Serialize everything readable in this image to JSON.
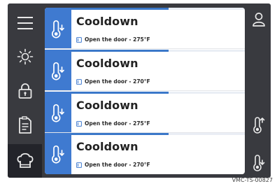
{
  "sidebar": {
    "items": [
      {
        "icon": "menu-icon"
      },
      {
        "icon": "sun-icon"
      },
      {
        "icon": "lock-icon"
      },
      {
        "icon": "document-icon"
      },
      {
        "icon": "chef-hat-icon",
        "active": true
      }
    ]
  },
  "right_bar": {
    "items": [
      {
        "icon": "user-icon"
      },
      {
        "icon": "thermometer-up-icon"
      },
      {
        "icon": "thermometer-down-icon"
      }
    ]
  },
  "cards": [
    {
      "title": "Cooldown",
      "subtitle": "Open the door - 275°F",
      "progress": 0.62
    },
    {
      "title": "Cooldown",
      "subtitle": "Open the door - 270°F",
      "progress": 0.62
    },
    {
      "title": "Cooldown",
      "subtitle": "Open the door - 275°F",
      "progress": 0.62
    },
    {
      "title": "Cooldown",
      "subtitle": "Open the door - 270°F",
      "progress": 0.62
    }
  ],
  "colors": {
    "panel": "#393a3f",
    "accent": "#3f7ad0"
  },
  "watermark": "VMC-TS-00827"
}
